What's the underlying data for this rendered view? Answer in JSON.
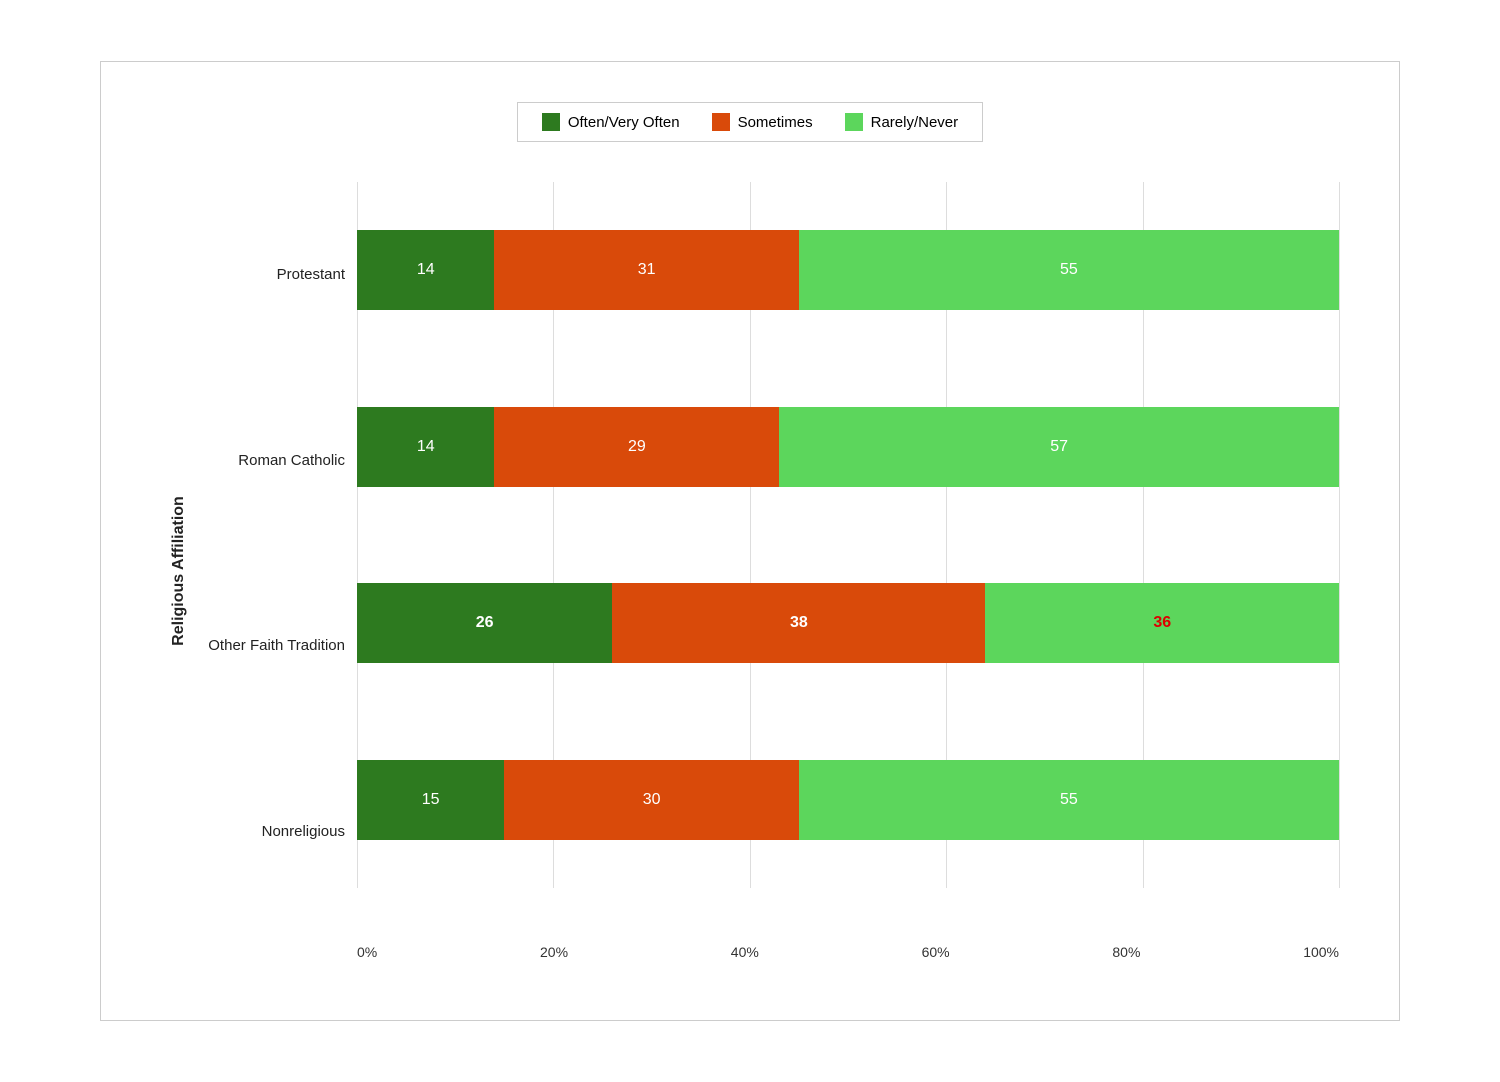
{
  "legend": {
    "items": [
      {
        "id": "often",
        "label": "Often/Very Often",
        "color": "#2d7a1f"
      },
      {
        "id": "sometimes",
        "label": "Sometimes",
        "color": "#d94a0a"
      },
      {
        "id": "rarely",
        "label": "Rarely/Never",
        "color": "#5cd65c"
      }
    ]
  },
  "yAxisLabel": "Religious Affiliation",
  "xAxisLabels": [
    "0%",
    "20%",
    "40%",
    "60%",
    "80%",
    "100%"
  ],
  "categories": [
    {
      "label": "Protestant",
      "segments": [
        {
          "value": 14,
          "pct": 14,
          "color": "#2d7a1f",
          "labelColor": "white",
          "bold": false
        },
        {
          "value": 31,
          "pct": 31,
          "color": "#d94a0a",
          "labelColor": "white",
          "bold": false
        },
        {
          "value": 55,
          "pct": 55,
          "color": "#5cd65c",
          "labelColor": "white",
          "bold": false
        }
      ]
    },
    {
      "label": "Roman Catholic",
      "segments": [
        {
          "value": 14,
          "pct": 14,
          "color": "#2d7a1f",
          "labelColor": "white",
          "bold": false
        },
        {
          "value": 29,
          "pct": 29,
          "color": "#d94a0a",
          "labelColor": "white",
          "bold": false
        },
        {
          "value": 57,
          "pct": 57,
          "color": "#5cd65c",
          "labelColor": "white",
          "bold": false
        }
      ]
    },
    {
      "label": "Other Faith Tradition",
      "segments": [
        {
          "value": 26,
          "pct": 26,
          "color": "#2d7a1f",
          "labelColor": "white",
          "bold": true
        },
        {
          "value": 38,
          "pct": 38,
          "color": "#d94a0a",
          "labelColor": "white",
          "bold": true
        },
        {
          "value": 36,
          "pct": 36,
          "color": "#5cd65c",
          "labelColor": "red",
          "bold": true
        }
      ]
    },
    {
      "label": "Nonreligious",
      "segments": [
        {
          "value": 15,
          "pct": 15,
          "color": "#2d7a1f",
          "labelColor": "white",
          "bold": false
        },
        {
          "value": 30,
          "pct": 30,
          "color": "#d94a0a",
          "labelColor": "white",
          "bold": false
        },
        {
          "value": 55,
          "pct": 55,
          "color": "#5cd65c",
          "labelColor": "white",
          "bold": false
        }
      ]
    }
  ]
}
